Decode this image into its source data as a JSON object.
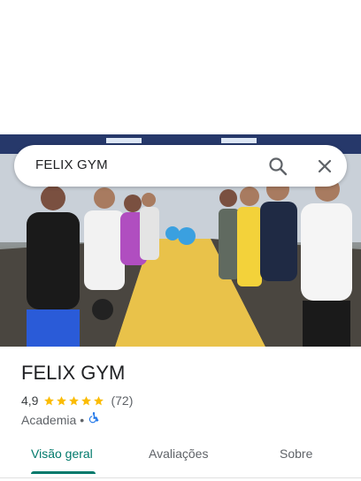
{
  "search": {
    "query": "FELIX GYM"
  },
  "place": {
    "name": "FELIX GYM",
    "rating": "4,9",
    "stars": 5,
    "review_count": "(72)",
    "category": "Academia",
    "separator": "•"
  },
  "tabs": [
    {
      "label": "Visão geral",
      "active": true
    },
    {
      "label": "Avaliações",
      "active": false
    },
    {
      "label": "Sobre",
      "active": false
    }
  ],
  "colors": {
    "accent": "#00796b",
    "star": "#fbbc04",
    "accessible_icon": "#1a73e8"
  },
  "icons": {
    "search": "search-icon",
    "close": "close-icon",
    "accessibility": "wheelchair-icon"
  }
}
